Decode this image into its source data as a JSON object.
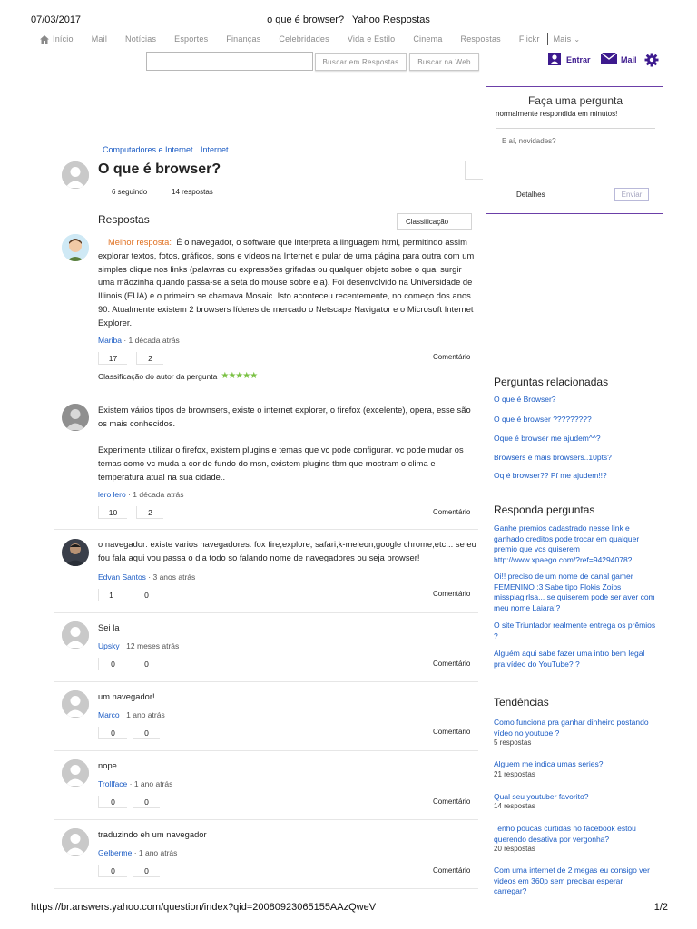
{
  "print": {
    "date": "07/03/2017",
    "title": "o que é browser? | Yahoo Respostas",
    "url": "https://br.answers.yahoo.com/question/index?qid=20080923065155AAzQweV",
    "page": "1/2"
  },
  "nav": {
    "items": [
      "Início",
      "Mail",
      "Notícias",
      "Esportes",
      "Finanças",
      "Celebridades",
      "Vida e Estilo",
      "Cinema",
      "Respostas",
      "Flickr"
    ],
    "more": "Mais"
  },
  "search": {
    "value": "",
    "answers_button": "Buscar em Respostas",
    "web_button": "Buscar na Web"
  },
  "user": {
    "signin": "Entrar",
    "mail": "Mail",
    "accent": "#3d1a8e"
  },
  "ask": {
    "title": "Faça uma pergunta",
    "subtitle": "normalmente respondida em minutos!",
    "placeholder": "E aí, novidades?",
    "details": "Detalhes",
    "send": "Enviar"
  },
  "question": {
    "categories": [
      "Computadores e Internet",
      "Internet"
    ],
    "title": "O que é browser?",
    "followers": "6 seguindo",
    "answer_count": "14 respostas"
  },
  "answers_header": {
    "title": "Respostas",
    "sort": "Classificação"
  },
  "answers": [
    {
      "best_label": "Melhor resposta:",
      "text": "É o navegador, o software que interpreta a linguagem html, permitindo assim explorar textos, fotos, gráficos, sons e vídeos na Internet e pular de uma página para outra com um simples clique nos links (palavras ou expressões grifadas ou qualquer objeto sobre o qual surgir uma mãozinha quando passa-se a seta do mouse sobre ela). Foi desenvolvido na Universidade de Illinois (EUA) e o primeiro se chamava Mosaic. Isto aconteceu recentemente, no começo dos anos 90. Atualmente existem 2 browsers líderes de mercado o Netscape Navigator e o Microsoft Internet Explorer.",
      "user": "Mariba",
      "time": " · 1 década atrás",
      "up": "17",
      "down": "2",
      "comment": "Comentário",
      "rating_label": "Classificação do autor da pergunta",
      "rating_stars": "★★★★★"
    },
    {
      "text": "Existem vários tipos de brownsers, existe o internet explorer, o firefox (excelente), opera, esse são os mais conhecidos.",
      "text2": "Experimente utilizar o firefox, existem plugins e temas que vc pode configurar. vc pode mudar os temas como vc muda a cor de fundo do msn, existem plugins tbm que mostram o clima e temperatura atual na sua cidade..",
      "user": "lero lero",
      "time": " · 1 década atrás",
      "up": "10",
      "down": "2",
      "comment": "Comentário"
    },
    {
      "text": "o navegador: existe varios navegadores: fox fire,explore, safari,k-meleon,google chrome,etc... se eu fou fala aqui vou passa o dia todo so falando nome de navegadores ou seja browser!",
      "user": "Edvan Santos",
      "time": " · 3 anos atrás",
      "up": "1",
      "down": "0",
      "comment": "Comentário"
    },
    {
      "text": "Sei la",
      "user": "Upsky",
      "time": " · 12 meses atrás",
      "up": "0",
      "down": "0",
      "comment": "Comentário"
    },
    {
      "text": "um navegador!",
      "user": "Marco",
      "time": " · 1 ano atrás",
      "up": "0",
      "down": "0",
      "comment": "Comentário"
    },
    {
      "text": "nope",
      "user": "Trollface",
      "time": " · 1 ano atrás",
      "up": "0",
      "down": "0",
      "comment": "Comentário"
    },
    {
      "text": "traduzindo eh um navegador",
      "user": "Gelberme",
      "time": " · 1 ano atrás",
      "up": "0",
      "down": "0",
      "comment": "Comentário"
    }
  ],
  "related": {
    "title": "Perguntas relacionadas",
    "links": [
      "O que é Browser?",
      "O que é browser ?????????",
      "Oque é browser me ajudem^^?",
      "Browsers e mais browsers..10pts?",
      "Oq é browser?? Pf me ajudem!!?"
    ]
  },
  "answer_more": {
    "title": "Responda perguntas",
    "links": [
      "Ganhe premios cadastrado nesse link e ganhado creditos pode trocar em qualquer premio que vcs quiserem http://www.xpaego.com/?ref=94294078?",
      "Oi!! preciso de um nome de canal gamer FEMENINO :3 Sabe tipo Flokis Zoibs misspiagirlsa... se quiserem pode ser aver com meu nome Laiara!?",
      "O site Triunfador realmente entrega os prêmios ?",
      "Alguém aqui sabe fazer uma intro bem legal pra vídeo do YouTube? ?"
    ]
  },
  "trends": {
    "title": "Tendências",
    "items": [
      {
        "q": "Como funciona pra ganhar dinheiro postando vídeo no youtube ?",
        "count": "5 respostas"
      },
      {
        "q": "Alguem me indica umas series?",
        "count": "21 respostas"
      },
      {
        "q": "Qual seu youtuber favorito?",
        "count": "14 respostas"
      },
      {
        "q": "Tenho poucas curtidas no facebook estou querendo desativa por vergonha?",
        "count": "20 respostas"
      },
      {
        "q": "Com uma internet de 2 megas eu consigo ver videos em 360p sem precisar esperar carregar?",
        "count": ""
      }
    ]
  }
}
